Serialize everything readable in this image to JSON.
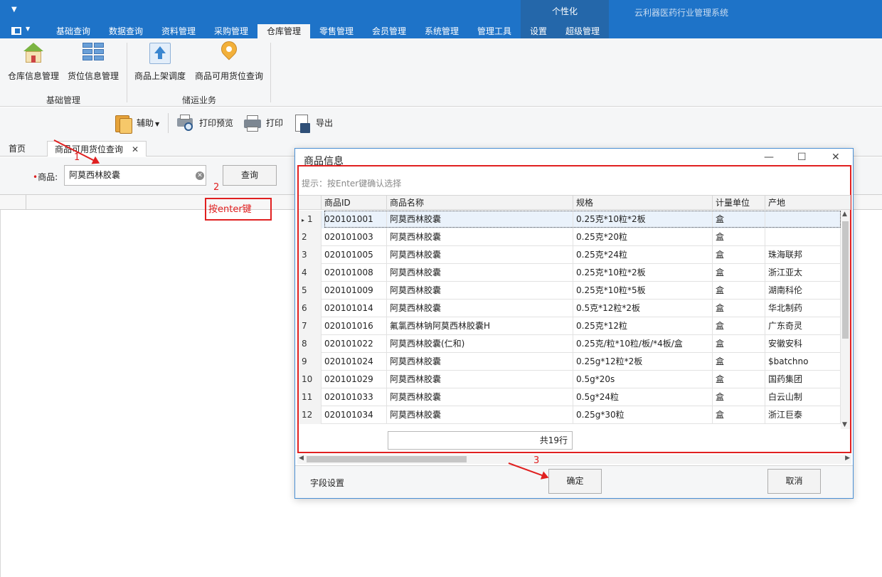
{
  "app": {
    "title": "云利器医药行业管理系统",
    "context_group": "个性化"
  },
  "ribbon_tabs": [
    "基础查询",
    "数据查询",
    "资料管理",
    "采购管理",
    "仓库管理",
    "零售管理",
    "会员管理",
    "系统管理",
    "管理工具",
    "设置",
    "超级管理"
  ],
  "ribbon_active_tab": "仓库管理",
  "ribbon": {
    "groups": [
      {
        "label": "基础管理",
        "items": [
          {
            "label": "仓库信息管理",
            "icon": "house-icon"
          },
          {
            "label": "货位信息管理",
            "icon": "shelf-grid-icon"
          }
        ]
      },
      {
        "label": "储运业务",
        "items": [
          {
            "label": "商品上架调度",
            "icon": "upload-icon"
          },
          {
            "label": "商品可用货位查询",
            "icon": "location-pin-icon"
          }
        ]
      }
    ]
  },
  "toolbar": {
    "assist": "辅助",
    "print_preview": "打印预览",
    "print": "打印",
    "export": "导出"
  },
  "doc_tabs": {
    "home": "首页",
    "current": "商品可用货位查询"
  },
  "query": {
    "label": "商品:",
    "value": "阿莫西林胶囊",
    "button": "查询"
  },
  "annotations": {
    "step1": "1",
    "step2": "2",
    "step2_text": "按enter键",
    "step3": "3"
  },
  "dialog": {
    "title": "商品信息",
    "hint": "提示：按Enter键确认选择",
    "columns": [
      "商品ID",
      "商品名称",
      "规格",
      "计量单位",
      "产地"
    ],
    "rows": [
      {
        "n": "1",
        "id": "020101001",
        "name": "阿莫西林胶囊",
        "spec": "0.25克*10粒*2板",
        "unit": "盒",
        "origin": ""
      },
      {
        "n": "2",
        "id": "020101003",
        "name": "阿莫西林胶囊",
        "spec": "0.25克*20粒",
        "unit": "盒",
        "origin": ""
      },
      {
        "n": "3",
        "id": "020101005",
        "name": "阿莫西林胶囊",
        "spec": "0.25克*24粒",
        "unit": "盒",
        "origin": "珠海联邦"
      },
      {
        "n": "4",
        "id": "020101008",
        "name": "阿莫西林胶囊",
        "spec": "0.25克*10粒*2板",
        "unit": "盒",
        "origin": "浙江亚太"
      },
      {
        "n": "5",
        "id": "020101009",
        "name": "阿莫西林胶囊",
        "spec": "0.25克*10粒*5板",
        "unit": "盒",
        "origin": "湖南科伦"
      },
      {
        "n": "6",
        "id": "020101014",
        "name": "阿莫西林胶囊",
        "spec": "0.5克*12粒*2板",
        "unit": "盒",
        "origin": "华北制药"
      },
      {
        "n": "7",
        "id": "020101016",
        "name": "氟氯西林钠阿莫西林胶囊H",
        "spec": "0.25克*12粒",
        "unit": "盒",
        "origin": "广东奇灵"
      },
      {
        "n": "8",
        "id": "020101022",
        "name": "阿莫西林胶囊(仁和)",
        "spec": "0.25克/粒*10粒/板/*4板/盒",
        "unit": "盒",
        "origin": "安徽安科"
      },
      {
        "n": "9",
        "id": "020101024",
        "name": "阿莫西林胶囊",
        "spec": "0.25g*12粒*2板",
        "unit": "盒",
        "origin": "$batchno"
      },
      {
        "n": "10",
        "id": "020101029",
        "name": "阿莫西林胶囊",
        "spec": "0.5g*20s",
        "unit": "盒",
        "origin": "国药集团"
      },
      {
        "n": "11",
        "id": "020101033",
        "name": "阿莫西林胶囊",
        "spec": "0.5g*24粒",
        "unit": "盒",
        "origin": "白云山制"
      },
      {
        "n": "12",
        "id": "020101034",
        "name": "阿莫西林胶囊",
        "spec": "0.25g*30粒",
        "unit": "盒",
        "origin": "浙江巨泰"
      }
    ],
    "total": "共19行",
    "field_settings": "字段设置",
    "ok": "确定",
    "cancel": "取消",
    "min_glyph": "—",
    "max_glyph": "☐",
    "close_glyph": "✕"
  }
}
